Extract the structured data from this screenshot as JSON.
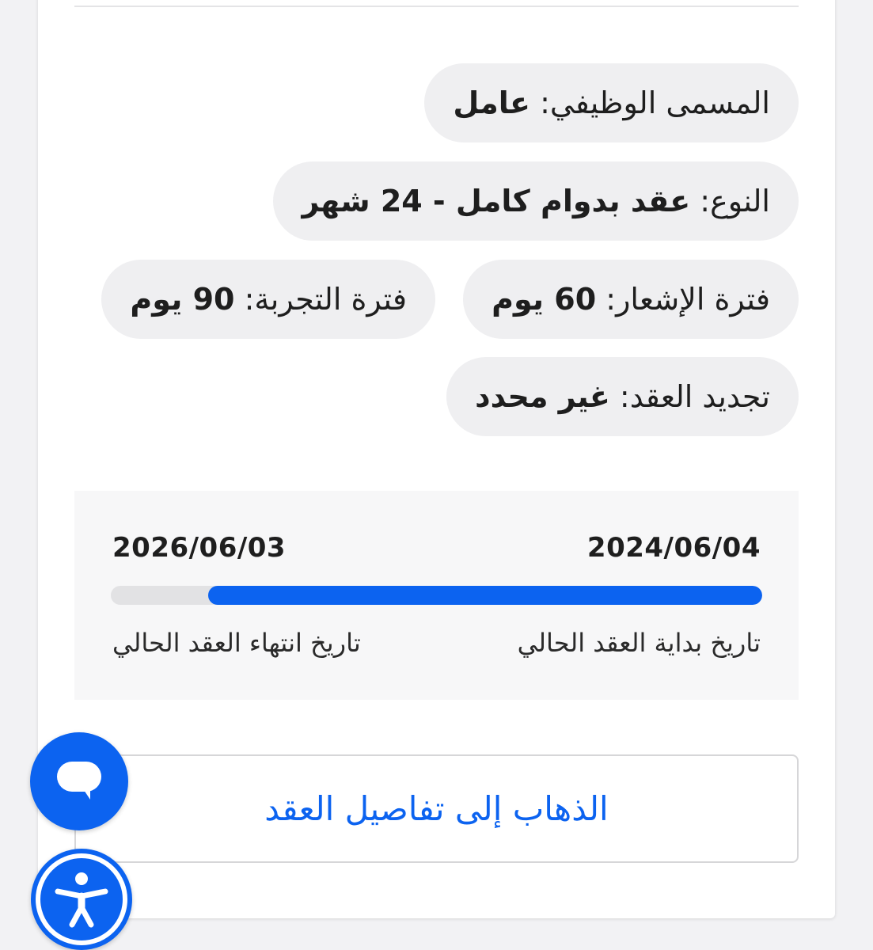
{
  "contract": {
    "job_title": {
      "label": "المسمى الوظيفي:",
      "value": "عامل"
    },
    "type": {
      "label": "النوع:",
      "value": "عقد بدوام كامل - 24 شهر"
    },
    "notice_period": {
      "label": "فترة الإشعار:",
      "value": "60 يوم"
    },
    "probation_period": {
      "label": "فترة التجربة:",
      "value": "90 يوم"
    },
    "renewal": {
      "label": "تجديد العقد:",
      "value": "غير محدد"
    }
  },
  "dates": {
    "start_date": "2024/06/04",
    "end_date": "2026/06/03",
    "start_caption": "تاريخ بداية العقد الحالي",
    "end_caption": "تاريخ انتهاء العقد الحالي",
    "progress_fraction": 0.85
  },
  "actions": {
    "go_to_details_label": "الذهاب إلى تفاصيل العقد"
  },
  "floating": {
    "chat_icon": "chat-bubble-icon",
    "accessibility_icon": "accessibility-icon"
  },
  "colors": {
    "accent": "#0c63f0",
    "pill_bg": "#efeff1",
    "track_bg": "#e2e2e4"
  }
}
